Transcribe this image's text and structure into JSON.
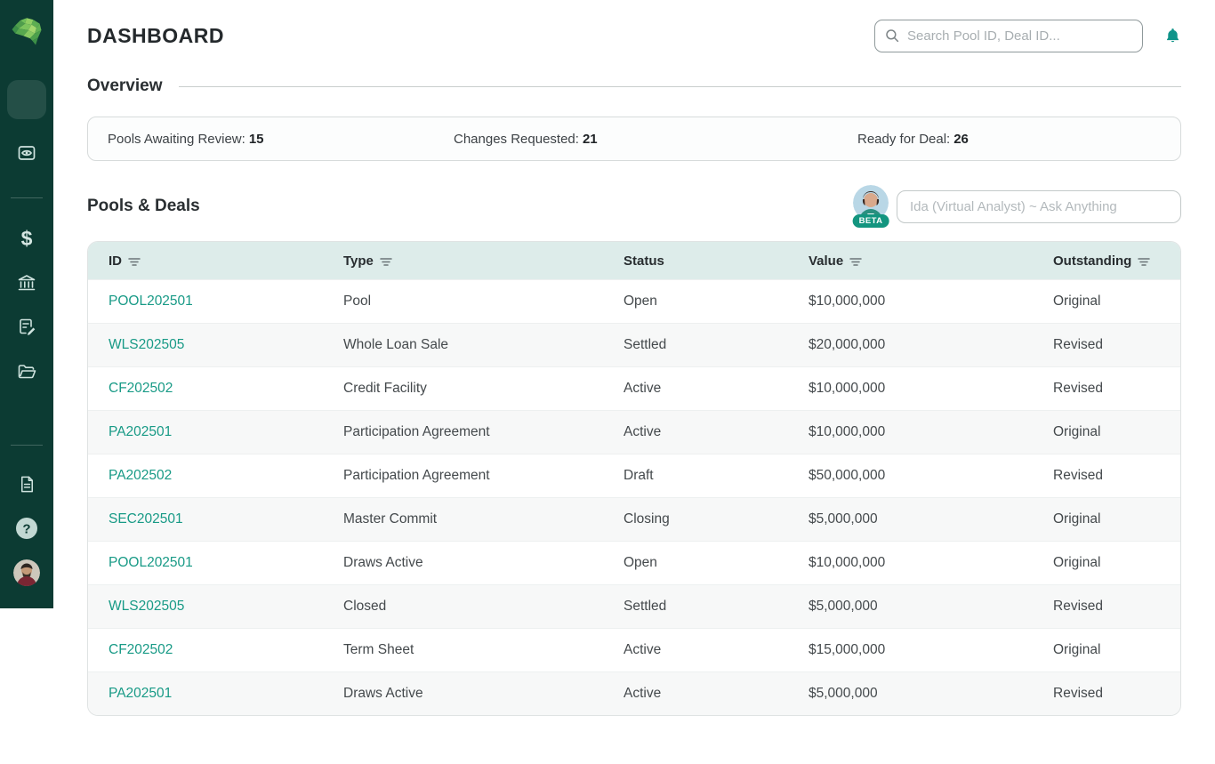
{
  "app": {
    "title": "DASHBOARD",
    "logo_icon": "brain-logo"
  },
  "header": {
    "search_placeholder": "Search Pool ID, Deal ID...",
    "icons": [
      "search-icon",
      "bell-icon"
    ]
  },
  "sidebar": {
    "icons": [
      "brain-logo",
      "home-icon",
      "eye-monitor-icon",
      "dollar-icon",
      "bank-icon",
      "edit-note-icon",
      "folder-icon",
      "document-icon",
      "help-icon",
      "profile-avatar"
    ],
    "dollar_glyph": "$",
    "active_item": "home"
  },
  "overview": {
    "heading": "Overview",
    "stats": [
      {
        "label": "Pools Awaiting Review:",
        "value": "15"
      },
      {
        "label": "Changes Requested:",
        "value": "21"
      },
      {
        "label": "Ready for Deal:",
        "value": "26"
      }
    ]
  },
  "pools_deals": {
    "heading": "Pools & Deals",
    "assistant": {
      "badge": "BETA",
      "placeholder": "Ida (Virtual Analyst) ~ Ask Anything"
    },
    "table": {
      "columns": [
        {
          "label": "ID",
          "filter": true
        },
        {
          "label": "Type",
          "filter": true
        },
        {
          "label": "Status",
          "filter": false
        },
        {
          "label": "Value",
          "filter": true
        },
        {
          "label": "Outstanding",
          "filter": true
        }
      ],
      "rows": [
        [
          "POOL202501",
          "Pool",
          "Open",
          "$10,000,000",
          "Original"
        ],
        [
          "WLS202505",
          "Whole Loan Sale",
          "Settled",
          "$20,000,000",
          "Revised"
        ],
        [
          "CF202502",
          "Credit Facility",
          "Active",
          "$10,000,000",
          "Revised"
        ],
        [
          "PA202501",
          "Participation Agreement",
          "Active",
          "$10,000,000",
          "Original"
        ],
        [
          "PA202502",
          "Participation Agreement",
          "Draft",
          "$50,000,000",
          "Revised"
        ],
        [
          "SEC202501",
          "Master Commit",
          "Closing",
          "$5,000,000",
          "Original"
        ],
        [
          "POOL202501",
          "Draws Active",
          "Open",
          "$10,000,000",
          "Original"
        ],
        [
          "WLS202505",
          "Closed",
          "Settled",
          "$5,000,000",
          "Revised"
        ],
        [
          "CF202502",
          "Term Sheet",
          "Active",
          "$15,000,000",
          "Original"
        ],
        [
          "PA202501",
          "Draws Active",
          "Active",
          "$5,000,000",
          "Revised"
        ]
      ]
    }
  },
  "colors": {
    "sidebar_bg": "#0c3b33",
    "accent_teal": "#189a86",
    "table_header_bg": "#ddecea",
    "row_alt_bg": "#f7f8f8",
    "badge_bg": "#13957f"
  }
}
